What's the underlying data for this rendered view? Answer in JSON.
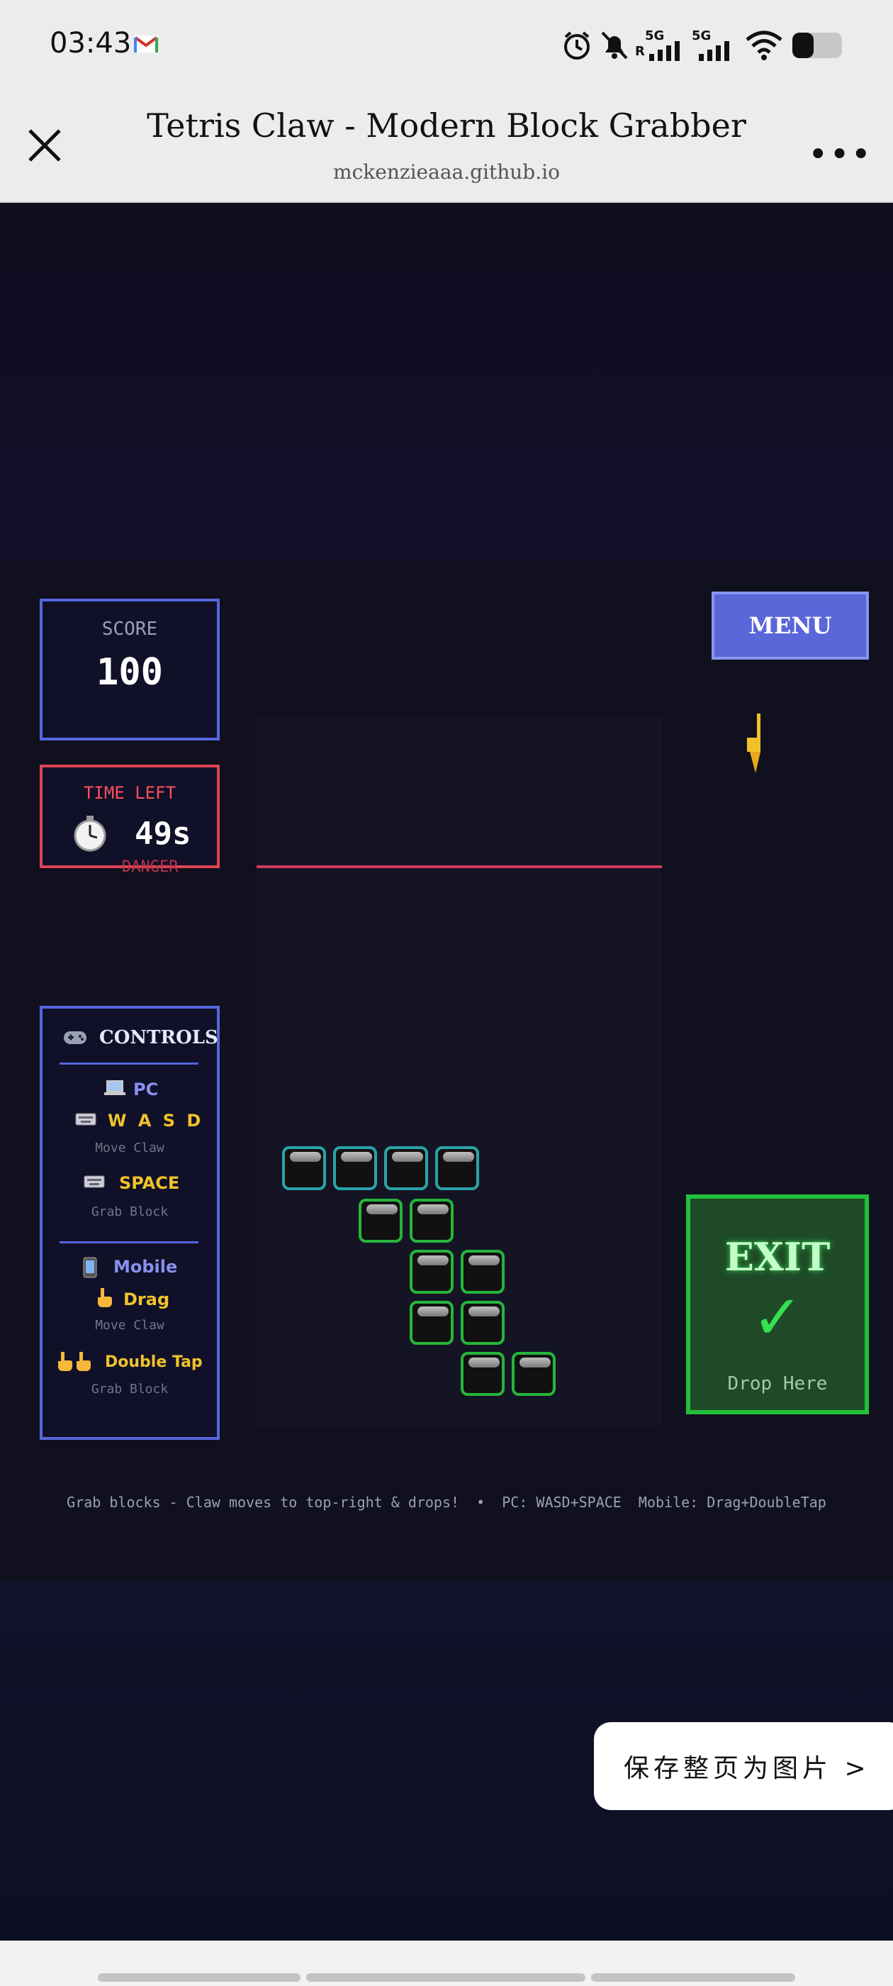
{
  "status_bar": {
    "time": "03:43",
    "icons": [
      "gmail-icon",
      "alarm-icon",
      "bell-off-icon",
      "signal-5g-icon",
      "signal-5g-icon",
      "wifi-icon",
      "battery-icon"
    ],
    "network1": "5G",
    "network2": "5G",
    "roaming": "R"
  },
  "browser": {
    "title": "Tetris Claw - Modern Block Grabber",
    "url": "mckenzieaaa.github.io",
    "more": "•••"
  },
  "game": {
    "score_label": "SCORE",
    "score_value": "100",
    "time_label": "TIME LEFT",
    "time_value": "49s",
    "danger_label": "DANGER",
    "menu_label": "MENU",
    "controls": {
      "heading": "CONTROLS",
      "pc_heading": "PC",
      "pc_move_keys": "W A S D",
      "pc_move_desc": "Move Claw",
      "pc_grab_key": "SPACE",
      "pc_grab_desc": "Grab Block",
      "mobile_heading": "Mobile",
      "mobile_move": "Drag",
      "mobile_move_desc": "Move Claw",
      "mobile_grab": "Double Tap",
      "mobile_grab_desc": "Grab Block"
    },
    "exit_label": "EXIT",
    "exit_check": "✓",
    "exit_sub": "Drop Here",
    "footer_hint": "Grab blocks - Claw moves to top-right & drops!  •  PC: WASD+SPACE  Mobile: Drag+DoubleTap",
    "colors": {
      "panel_border": "#5566dd",
      "time_border": "#dd4455",
      "block_cyan": "#2aa3a8",
      "block_green": "#26b53a",
      "exit_green": "#22c03a",
      "menu_bg": "#5a67d8"
    }
  },
  "save_button": "保存整页为图片 >"
}
